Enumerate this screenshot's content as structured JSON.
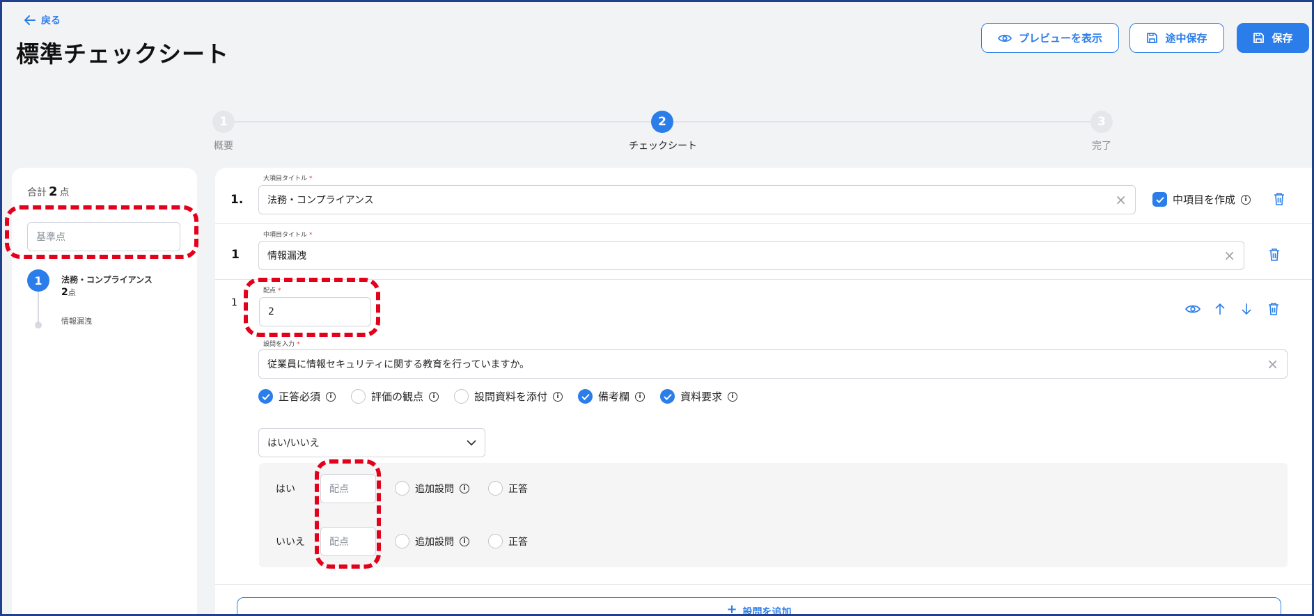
{
  "header": {
    "back_label": "戻る",
    "title": "標準チェックシート",
    "preview_label": "プレビューを表示",
    "draft_save_label": "途中保存",
    "save_label": "保存"
  },
  "stepper": {
    "steps": [
      {
        "number": "1",
        "label": "概要",
        "state": "done"
      },
      {
        "number": "2",
        "label": "チェックシート",
        "state": "active"
      },
      {
        "number": "3",
        "label": "完了",
        "state": "pending"
      }
    ]
  },
  "sidebar": {
    "total_prefix": "合計",
    "total_value": "2",
    "total_unit": "点",
    "baseline_placeholder": "基準点",
    "items": [
      {
        "number": "1",
        "title": "法務・コンプライアンス",
        "points": "2",
        "points_unit": "点",
        "children": [
          {
            "label": "情報漏洩"
          }
        ]
      }
    ]
  },
  "main": {
    "major": {
      "number": "1.",
      "label": "大項目タイトル",
      "value": "法務・コンプライアンス",
      "create_mid_label": "中項目を作成"
    },
    "middle": {
      "number": "1",
      "label": "中項目タイトル",
      "value": "情報漏洩"
    },
    "question": {
      "number": "1",
      "points_label": "配点",
      "points_value": "2",
      "question_label": "設問を入力",
      "question_value": "従業員に情報セキュリティに関する教育を行っていますか。",
      "options": [
        {
          "label": "正答必須",
          "checked": true
        },
        {
          "label": "評価の観点",
          "checked": false
        },
        {
          "label": "設問資料を添付",
          "checked": false
        },
        {
          "label": "備考欄",
          "checked": true
        },
        {
          "label": "資料要求",
          "checked": true
        }
      ],
      "answer_type": "はい/いいえ",
      "answers": [
        {
          "label": "はい",
          "points_placeholder": "配点",
          "extra_label": "追加設問",
          "correct_label": "正答"
        },
        {
          "label": "いいえ",
          "points_placeholder": "配点",
          "extra_label": "追加設問",
          "correct_label": "正答"
        }
      ]
    },
    "add_question_label": "設問を追加"
  },
  "colors": {
    "accent": "#2b7de9",
    "highlight": "#e3001b",
    "border": "#1f3f8f"
  }
}
